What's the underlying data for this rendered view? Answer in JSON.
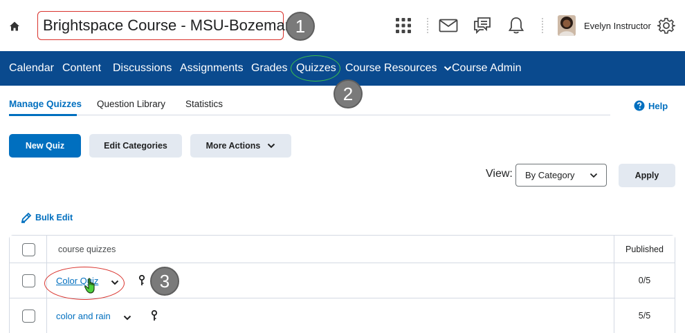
{
  "header": {
    "course_title": "Brightspace Course - MSU-Bozeman",
    "user_name": "Evelyn Instructor",
    "icons": [
      "home-icon",
      "apps-grid-icon",
      "mail-icon",
      "chat-icon",
      "bell-icon",
      "gear-icon"
    ]
  },
  "callouts": [
    "1",
    "2",
    "3"
  ],
  "nav": {
    "items": [
      "Calendar",
      "Content",
      "Discussions",
      "Assignments",
      "Grades",
      "Quizzes",
      "Course Resources",
      "Course Admin"
    ],
    "active": "Quizzes"
  },
  "tabs": {
    "items": [
      "Manage Quizzes",
      "Question Library",
      "Statistics"
    ],
    "active": "Manage Quizzes",
    "help": "Help"
  },
  "toolbar": {
    "new_quiz": "New Quiz",
    "edit_categories": "Edit Categories",
    "more_actions": "More Actions"
  },
  "view": {
    "label": "View:",
    "selected": "By Category",
    "apply": "Apply"
  },
  "bulk_edit": "Bulk Edit",
  "table": {
    "header_name": "course quizzes",
    "header_published": "Published",
    "rows": [
      {
        "name": "Color Quiz",
        "published": "0/5"
      },
      {
        "name": "color and rain",
        "published": "5/5"
      }
    ]
  },
  "colors": {
    "nav_bg": "#0a4a8e",
    "primary": "#006fbf",
    "highlight_red": "#d9312b",
    "highlight_green": "#3ec34a"
  }
}
